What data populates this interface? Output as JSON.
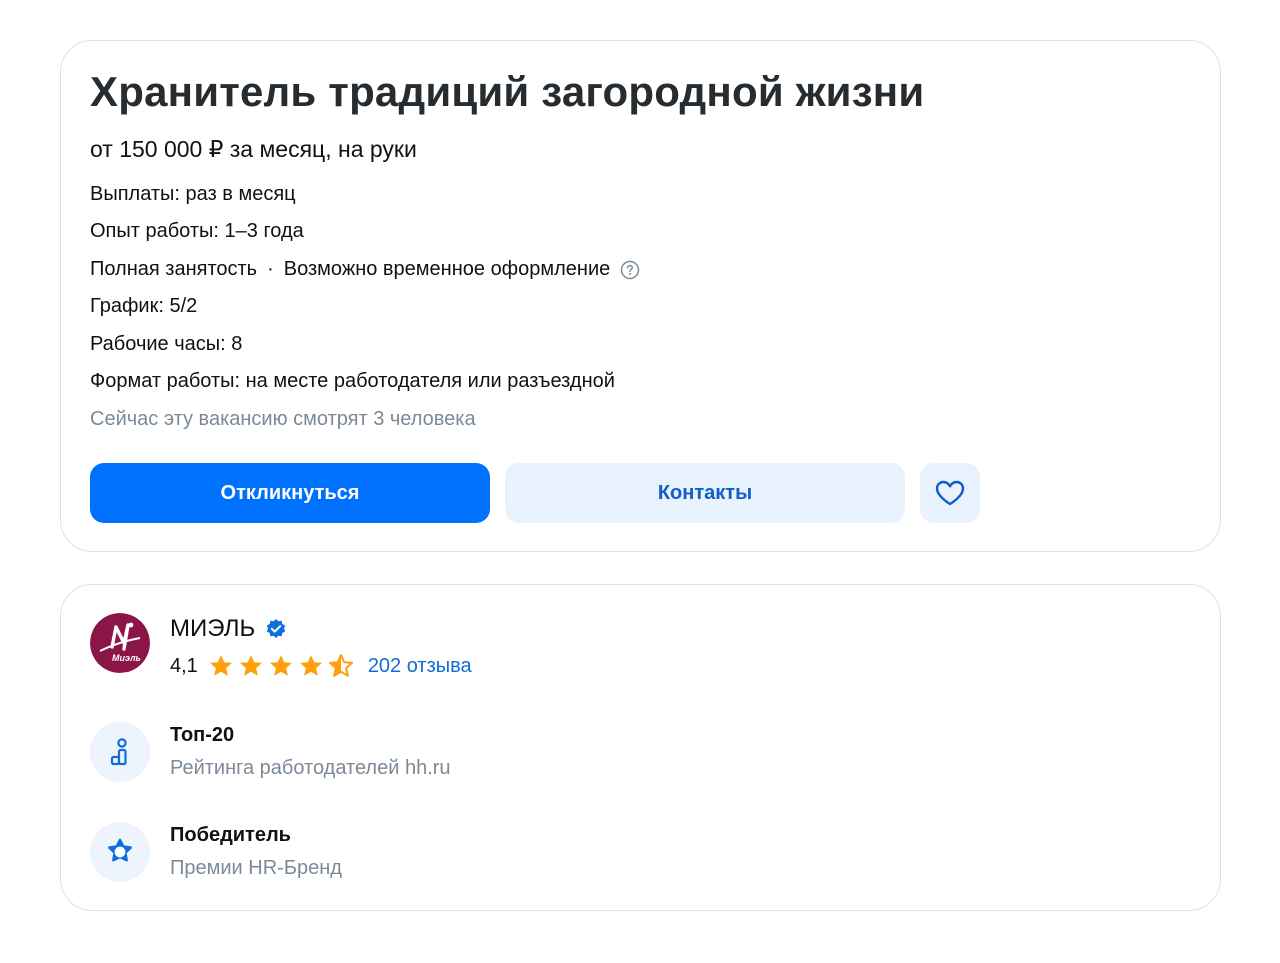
{
  "vacancy": {
    "title": "Хранитель традиций загородной жизни",
    "salary": "от 150 000 ₽ за месяц, на руки",
    "payments": "Выплаты: раз в месяц",
    "experience": "Опыт работы: 1–3 года",
    "employment": "Полная занятость",
    "employment_separator": "·",
    "employment_extra": "Возможно временное оформление",
    "schedule": "График: 5/2",
    "hours": "Рабочие часы: 8",
    "work_format": "Формат работы: на месте работодателя или разъездной",
    "viewers": "Сейчас эту вакансию смотрят 3 человека",
    "apply_label": "Откликнуться",
    "contacts_label": "Контакты",
    "favorite_icon": "heart-icon"
  },
  "employer": {
    "name": "МИЭЛЬ",
    "logo_text": "Миэль",
    "rating": "4,1",
    "stars": 4.5,
    "reviews": "202 отзыва",
    "awards": [
      {
        "title": "Топ-20",
        "subtitle": "Рейтинга работодателей hh.ru",
        "icon": "ranking-icon"
      },
      {
        "title": "Победитель",
        "subtitle": "Премии HR-Бренд",
        "icon": "badge-icon"
      }
    ]
  },
  "colors": {
    "primary": "#0070ff",
    "secondary_bg": "#e8f2fd",
    "link": "#0f6ed9",
    "muted": "#7c8a98",
    "star": "#ff9f0a",
    "logo_bg": "#8b1547"
  }
}
